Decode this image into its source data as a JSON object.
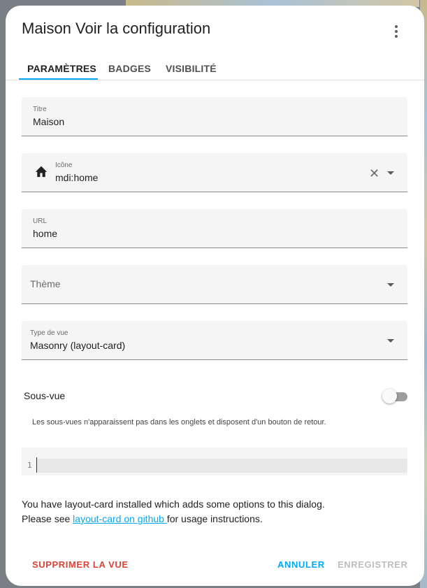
{
  "dialog": {
    "title": "Maison Voir la configuration",
    "menu_icon": "more-vert-icon"
  },
  "tabs": [
    {
      "label": "PARAMÈTRES",
      "active": true
    },
    {
      "label": "BADGES",
      "active": false
    },
    {
      "label": "VISIBILITÉ",
      "active": false
    }
  ],
  "fields": {
    "title": {
      "label": "Titre",
      "value": "Maison"
    },
    "icon": {
      "label": "Icône",
      "value": "mdi:home",
      "icon": "home-icon"
    },
    "url": {
      "label": "URL",
      "value": "home"
    },
    "theme": {
      "placeholder": "Thème",
      "value": ""
    },
    "view_type": {
      "label": "Type de vue",
      "value": "Masonry (layout-card)"
    }
  },
  "subview": {
    "label": "Sous-vue",
    "enabled": false,
    "help": "Les sous-vues n'apparaissent pas dans les onglets et disposent d'un bouton de retour."
  },
  "code_editor": {
    "line_numbers": [
      "1"
    ],
    "content": ""
  },
  "info": {
    "line1": "You have layout-card installed which adds some options to this dialog.",
    "line2_prefix": "Please see ",
    "link_text": "layout-card on github ",
    "line2_suffix": "for usage instructions."
  },
  "buttons": {
    "delete": "SUPPRIMER LA VUE",
    "cancel": "ANNULER",
    "save": "ENREGISTRER"
  },
  "colors": {
    "accent": "#03a9f4",
    "danger": "#db4437",
    "disabled": "#bdbdbd"
  }
}
